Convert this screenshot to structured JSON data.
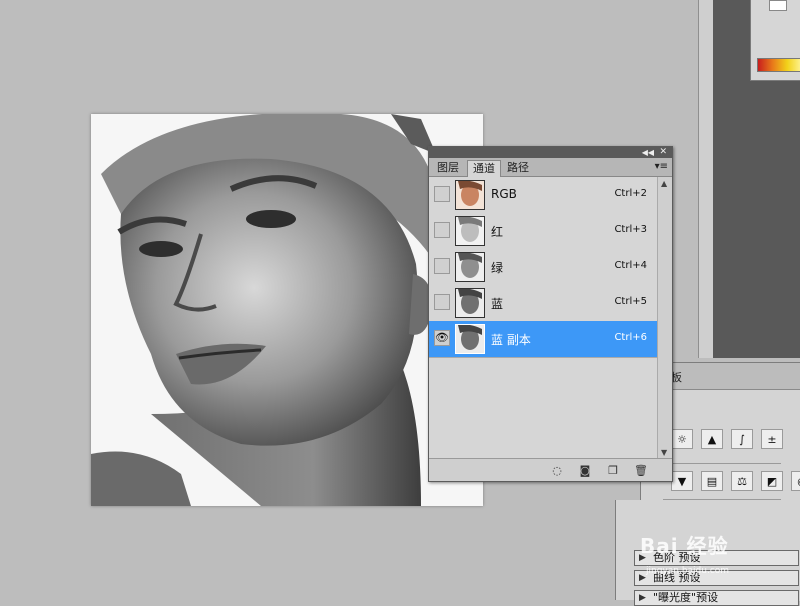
{
  "channels_panel": {
    "tabs": [
      {
        "label": "图层",
        "active": false
      },
      {
        "label": "通道",
        "active": true
      },
      {
        "label": "路径",
        "active": false
      }
    ],
    "channels": [
      {
        "name": "RGB",
        "shortcut": "Ctrl+2",
        "visible": false,
        "selected": false,
        "thumb": "color"
      },
      {
        "name": "红",
        "shortcut": "Ctrl+3",
        "visible": false,
        "selected": false,
        "thumb": "gray-light"
      },
      {
        "name": "绿",
        "shortcut": "Ctrl+4",
        "visible": false,
        "selected": false,
        "thumb": "gray"
      },
      {
        "name": "蓝",
        "shortcut": "Ctrl+5",
        "visible": false,
        "selected": false,
        "thumb": "gray-dark"
      },
      {
        "name": "蓝 副本",
        "shortcut": "Ctrl+6",
        "visible": true,
        "selected": true,
        "thumb": "gray-dark"
      }
    ],
    "eye_glyph": "👁",
    "footer_icons": [
      "load-selection-icon",
      "save-selection-icon",
      "new-channel-icon",
      "trash-icon"
    ]
  },
  "adjustments_panel": {
    "tab_fragment": "板"
  },
  "presets_panel": {
    "items": [
      "色阶 预设",
      "曲线 预设",
      "\"曝光度\"预设"
    ]
  },
  "watermark": {
    "text": "Bai 经验",
    "sub": "jingyan.baidu.com"
  },
  "colors": {
    "selection": "#3d98f7",
    "panel_bg": "#d6d6d6",
    "workspace": "#bdbdbd"
  }
}
